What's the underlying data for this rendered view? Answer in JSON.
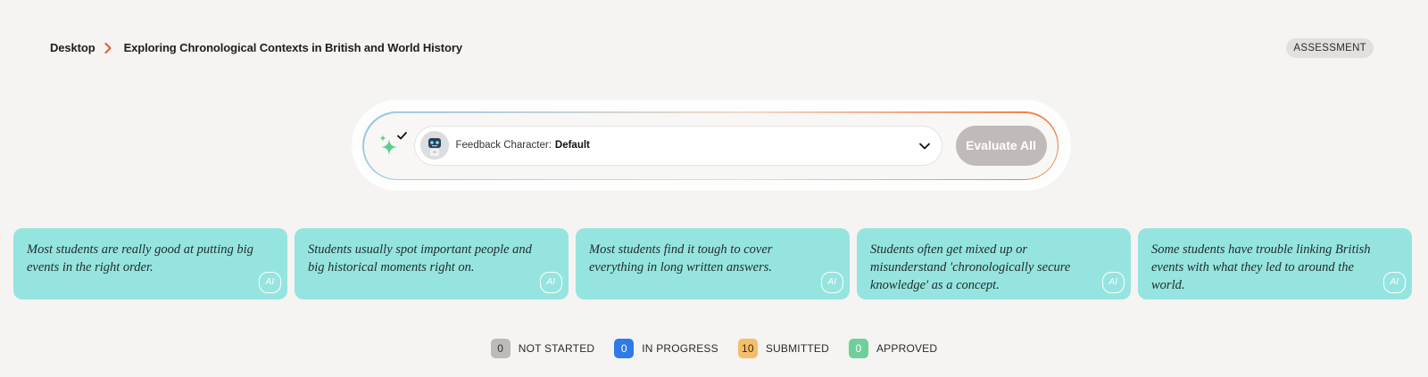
{
  "breadcrumb": {
    "root": "Desktop",
    "current": "Exploring Chronological Contexts in British and World History"
  },
  "badge": "ASSESSMENT",
  "feedback": {
    "label": "Feedback Character:",
    "value": "Default",
    "evaluate_label": "Evaluate All"
  },
  "cards": [
    {
      "text": "Most students are really good at putting big events in the right order.",
      "tag": "AI"
    },
    {
      "text": "Students usually spot important people and big historical moments right on.",
      "tag": "AI"
    },
    {
      "text": "Most students find it tough to cover everything in long written answers.",
      "tag": "AI"
    },
    {
      "text": "Students often get mixed up or misunderstand 'chronologically secure knowledge' as a concept.",
      "tag": "AI"
    },
    {
      "text": "Some students have trouble linking British events with what they led to around the world.",
      "tag": "AI"
    }
  ],
  "statuses": [
    {
      "count": "0",
      "label": "NOT STARTED",
      "bg": "#bdbab7",
      "fg": "#333333"
    },
    {
      "count": "0",
      "label": "IN PROGRESS",
      "bg": "#2f7be6",
      "fg": "#ffffff"
    },
    {
      "count": "10",
      "label": "SUBMITTED",
      "bg": "#f4be6c",
      "fg": "#3a2a10"
    },
    {
      "count": "0",
      "label": "APPROVED",
      "bg": "#6fcf9a",
      "fg": "#ffffff"
    }
  ],
  "colors": {
    "accent": "#e8572a",
    "card": "#96e4e0",
    "sparkle": "#5ccf8f"
  }
}
